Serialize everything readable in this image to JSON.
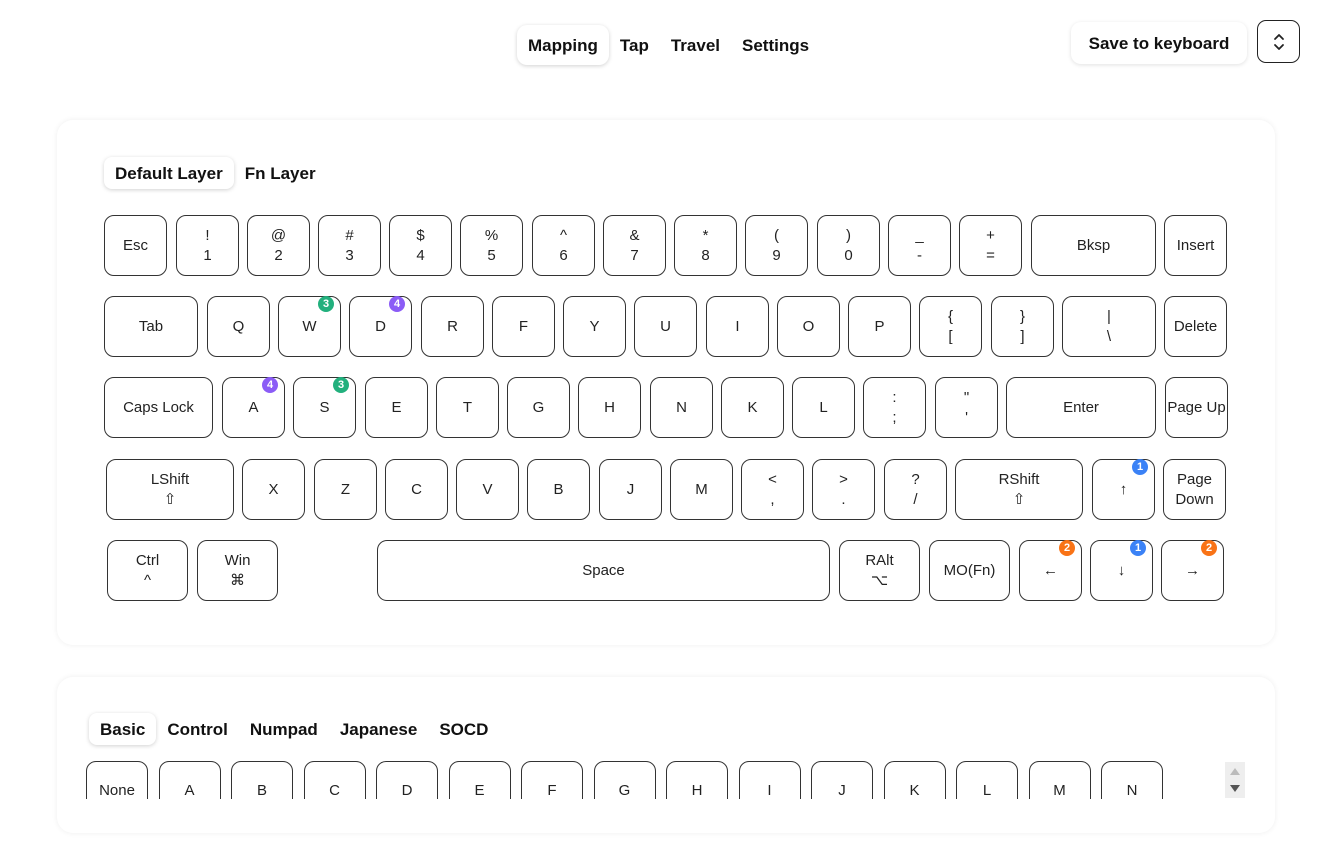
{
  "nav": {
    "tabs": [
      "Mapping",
      "Tap",
      "Travel",
      "Settings"
    ],
    "active": 0
  },
  "actions": {
    "save_label": "Save to keyboard"
  },
  "layers": {
    "tabs": [
      "Default Layer",
      "Fn Layer"
    ],
    "active": 0
  },
  "colors": {
    "green": "#22b07d",
    "purple": "#8b5cf6",
    "blue": "#3b82f6",
    "orange": "#f97316"
  },
  "keyboard": {
    "rows": [
      [
        {
          "top": "Esc"
        },
        {
          "top": "!",
          "bottom": "1"
        },
        {
          "top": "@",
          "bottom": "2"
        },
        {
          "top": "#",
          "bottom": "3"
        },
        {
          "top": "$",
          "bottom": "4"
        },
        {
          "top": "%",
          "bottom": "5"
        },
        {
          "top": "^",
          "bottom": "6"
        },
        {
          "top": "&",
          "bottom": "7"
        },
        {
          "top": "*",
          "bottom": "8"
        },
        {
          "top": "(",
          "bottom": "9"
        },
        {
          "top": ")",
          "bottom": "0"
        },
        {
          "top": "_",
          "bottom": "-"
        },
        {
          "top": "+",
          "bottom": "="
        },
        {
          "top": "Bksp"
        },
        {
          "top": "Insert"
        }
      ],
      [
        {
          "top": "Tab"
        },
        {
          "top": "Q"
        },
        {
          "top": "W",
          "badge": "3",
          "badge_color": "green"
        },
        {
          "top": "D",
          "badge": "4",
          "badge_color": "purple"
        },
        {
          "top": "R"
        },
        {
          "top": "F"
        },
        {
          "top": "Y"
        },
        {
          "top": "U"
        },
        {
          "top": "I"
        },
        {
          "top": "O"
        },
        {
          "top": "P"
        },
        {
          "top": "{",
          "bottom": "["
        },
        {
          "top": "}",
          "bottom": "]"
        },
        {
          "top": "|",
          "bottom": "\\"
        },
        {
          "top": "Delete"
        }
      ],
      [
        {
          "top": "Caps Lock"
        },
        {
          "top": "A",
          "badge": "4",
          "badge_color": "purple"
        },
        {
          "top": "S",
          "badge": "3",
          "badge_color": "green"
        },
        {
          "top": "E"
        },
        {
          "top": "T"
        },
        {
          "top": "G"
        },
        {
          "top": "H"
        },
        {
          "top": "N"
        },
        {
          "top": "K"
        },
        {
          "top": "L"
        },
        {
          "top": ":",
          "bottom": ";"
        },
        {
          "top": "\"",
          "bottom": "'"
        },
        {
          "top": "Enter"
        },
        {
          "top": "Page Up"
        }
      ],
      [
        {
          "top": "LShift",
          "bottom": "⇧"
        },
        {
          "top": "X"
        },
        {
          "top": "Z"
        },
        {
          "top": "C"
        },
        {
          "top": "V"
        },
        {
          "top": "B"
        },
        {
          "top": "J"
        },
        {
          "top": "M"
        },
        {
          "top": "<",
          "bottom": ","
        },
        {
          "top": ">",
          "bottom": "."
        },
        {
          "top": "?",
          "bottom": "/"
        },
        {
          "top": "RShift",
          "bottom": "⇧"
        },
        {
          "top": "↑",
          "badge": "1",
          "badge_color": "blue"
        },
        {
          "top": "Page",
          "bottom": "Down"
        }
      ],
      [
        {
          "top": "Ctrl",
          "bottom": "^"
        },
        {
          "top": "Win",
          "bottom": "⌘"
        },
        {
          "top": "Space"
        },
        {
          "top": "RAlt",
          "bottom": "⌥"
        },
        {
          "top": "MO(Fn)"
        },
        {
          "top": "←",
          "badge": "2",
          "badge_color": "orange"
        },
        {
          "top": "↓",
          "badge": "1",
          "badge_color": "blue"
        },
        {
          "top": "→",
          "badge": "2",
          "badge_color": "orange"
        }
      ]
    ]
  },
  "keycodes": {
    "tabs": [
      "Basic",
      "Control",
      "Numpad",
      "Japanese",
      "SOCD"
    ],
    "active": 0,
    "items": [
      "None",
      "A",
      "B",
      "C",
      "D",
      "E",
      "F",
      "G",
      "H",
      "I",
      "J",
      "K",
      "L",
      "M",
      "N"
    ]
  }
}
